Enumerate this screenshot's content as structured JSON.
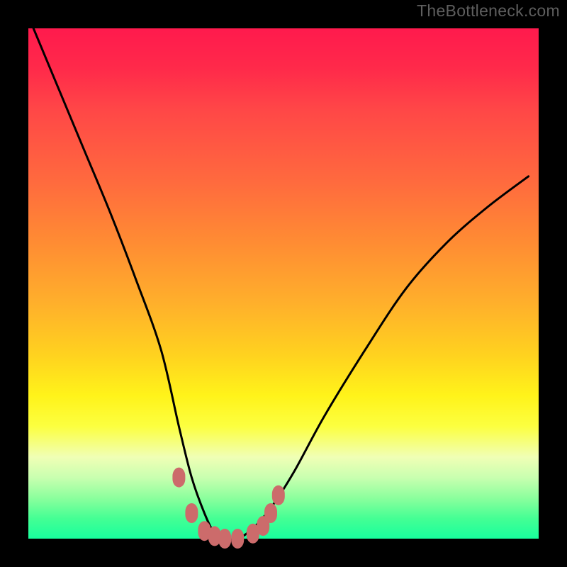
{
  "watermark": "TheBottleneck.com",
  "colors": {
    "frame": "#000000",
    "gradient_top": "#ff1a4d",
    "gradient_mid": "#fff31a",
    "gradient_bottom": "#18ff9d",
    "curve": "#000000",
    "markers": "#cc6b6b"
  },
  "chart_data": {
    "type": "line",
    "title": "",
    "xlabel": "",
    "ylabel": "",
    "xlim": [
      0,
      1
    ],
    "ylim": [
      0,
      1
    ],
    "note": "V-shaped bottleneck curve; x is normalized hardware parameter, y is bottleneck percentage (1 = 100% at top, 0 = 0% at bottom). Markers cluster at the minimum.",
    "series": [
      {
        "name": "bottleneck-curve",
        "x": [
          0.01,
          0.06,
          0.11,
          0.16,
          0.21,
          0.26,
          0.295,
          0.32,
          0.345,
          0.365,
          0.385,
          0.41,
          0.44,
          0.475,
          0.52,
          0.58,
          0.66,
          0.74,
          0.82,
          0.9,
          0.98
        ],
        "y": [
          1.0,
          0.88,
          0.76,
          0.64,
          0.51,
          0.37,
          0.22,
          0.12,
          0.05,
          0.01,
          0.0,
          0.0,
          0.02,
          0.06,
          0.13,
          0.24,
          0.37,
          0.49,
          0.58,
          0.65,
          0.71
        ]
      }
    ],
    "markers": {
      "name": "marker-points",
      "x": [
        0.295,
        0.32,
        0.345,
        0.365,
        0.385,
        0.41,
        0.44,
        0.46,
        0.475,
        0.49
      ],
      "y": [
        0.12,
        0.05,
        0.015,
        0.005,
        0.0,
        0.0,
        0.01,
        0.025,
        0.05,
        0.085
      ]
    }
  }
}
